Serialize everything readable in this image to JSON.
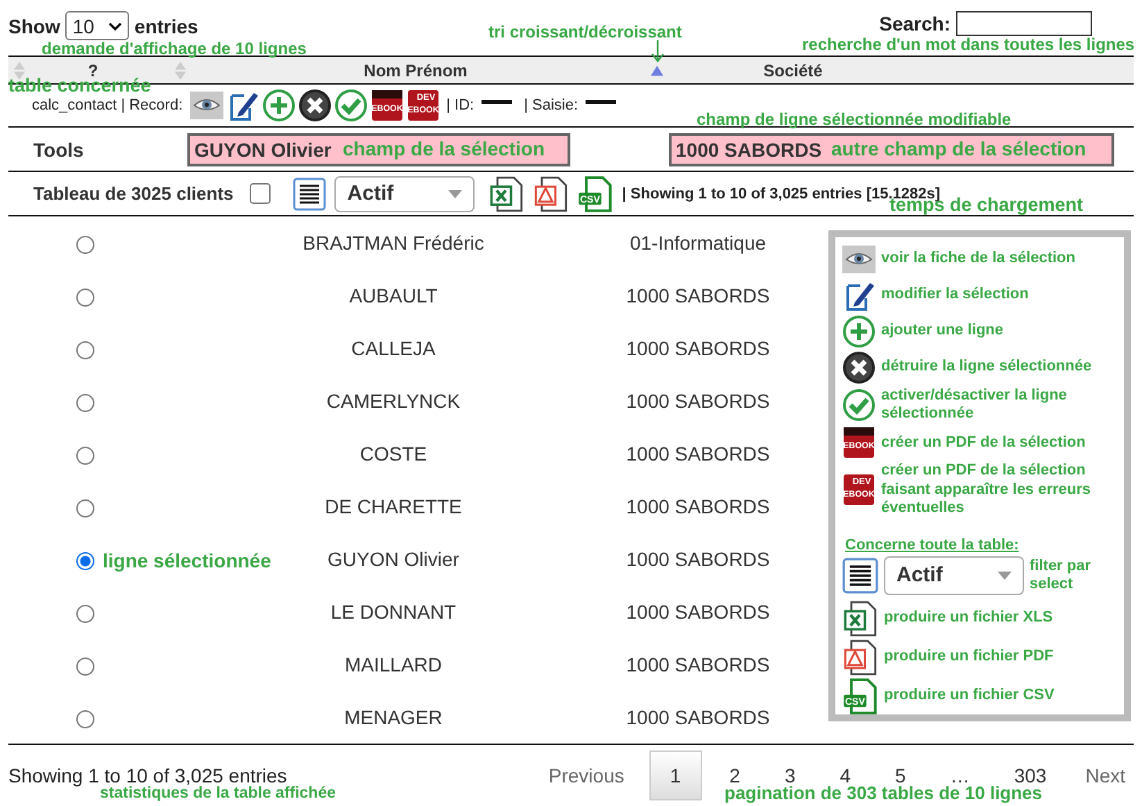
{
  "length_control": {
    "label_before": "Show",
    "value": "10",
    "label_after": "entries"
  },
  "search": {
    "label": "Search:"
  },
  "columns": [
    {
      "label": "?",
      "sorted": false
    },
    {
      "label": "Nom Prénom",
      "sorted": false
    },
    {
      "label": "Société",
      "sorted": true
    }
  ],
  "record_bar": {
    "table_label": "calc_contact | Record:",
    "tools": [
      {
        "kind": "view"
      },
      {
        "kind": "edit"
      },
      {
        "kind": "add"
      },
      {
        "kind": "delete"
      },
      {
        "kind": "toggle"
      },
      {
        "kind": "ebook",
        "badge": "EBOOK"
      },
      {
        "kind": "dev_ebook",
        "badge_top": "DEV",
        "badge": "EBOOK"
      }
    ],
    "id_label": "| ID:",
    "saisie_label": "| Saisie:"
  },
  "tools_row": {
    "label": "Tools",
    "fields": [
      {
        "value": "GUYON Olivier"
      },
      {
        "value": "1000 SABORDS"
      }
    ]
  },
  "table_toolbar": {
    "title": "Tableau de 3025 clients",
    "checked": false,
    "filter": {
      "value": "Actif"
    },
    "exports": [
      {
        "kind": "xls"
      },
      {
        "kind": "pdf"
      },
      {
        "kind": "csv",
        "badge": "CSV"
      }
    ],
    "info": "| Showing 1 to 10 of 3,025 entries [15.1282s]"
  },
  "rows": [
    {
      "name": "BRAJTMAN Frédéric",
      "company": "01-Informatique",
      "selected": false
    },
    {
      "name": "AUBAULT",
      "company": "1000 SABORDS",
      "selected": false
    },
    {
      "name": "CALLEJA",
      "company": "1000 SABORDS",
      "selected": false
    },
    {
      "name": "CAMERLYNCK",
      "company": "1000 SABORDS",
      "selected": false
    },
    {
      "name": "COSTE",
      "company": "1000 SABORDS",
      "selected": false
    },
    {
      "name": "DE CHARETTE",
      "company": "1000 SABORDS",
      "selected": false
    },
    {
      "name": "GUYON Olivier",
      "company": "1000 SABORDS",
      "selected": true
    },
    {
      "name": "LE DONNANT",
      "company": "1000 SABORDS",
      "selected": false
    },
    {
      "name": "MAILLARD",
      "company": "1000 SABORDS",
      "selected": false
    },
    {
      "name": "MENAGER",
      "company": "1000 SABORDS",
      "selected": false
    }
  ],
  "legend": {
    "items": [
      {
        "kind": "view",
        "text": "voir la fiche de la sélection"
      },
      {
        "kind": "edit",
        "text": "modifier la sélection"
      },
      {
        "kind": "add",
        "text": "ajouter une ligne"
      },
      {
        "kind": "delete",
        "text": "détruire la ligne sélectionnée"
      },
      {
        "kind": "toggle",
        "text": "activer/désactiver la ligne sélectionnée"
      },
      {
        "kind": "ebook",
        "badge": "EBOOK",
        "text": "créer un PDF de la sélection"
      },
      {
        "kind": "dev_ebook",
        "badge_top": "DEV",
        "badge": "EBOOK",
        "text": "créer un PDF de la sélection faisant apparaître les erreurs éventuelles"
      }
    ],
    "section_title": "Concerne toute la table:",
    "filter": {
      "value": "Actif",
      "text": "filter par select"
    },
    "exports": [
      {
        "kind": "xls",
        "text": "produire un fichier XLS"
      },
      {
        "kind": "pdf",
        "text": "produire un fichier PDF"
      },
      {
        "kind": "csv",
        "badge": "CSV",
        "text": "produire un fichier CSV"
      }
    ]
  },
  "footer": {
    "info": "Showing 1 to 10 of 3,025 entries",
    "pagination": [
      {
        "kind": "link",
        "label": "Previous",
        "selected": false
      },
      {
        "kind": "page",
        "label": "1",
        "selected": true
      },
      {
        "kind": "page",
        "label": "2",
        "selected": false
      },
      {
        "kind": "page",
        "label": "3",
        "selected": false
      },
      {
        "kind": "page",
        "label": "4",
        "selected": false
      },
      {
        "kind": "page",
        "label": "5",
        "selected": false
      },
      {
        "kind": "ellipsis",
        "label": "…"
      },
      {
        "kind": "page",
        "label": "303",
        "selected": false
      },
      {
        "kind": "link",
        "label": "Next",
        "selected": false
      }
    ]
  },
  "annotations": [
    {
      "kind": "length",
      "text": "demande d'affichage de 10 lignes"
    },
    {
      "kind": "sort",
      "text": "tri croissant/décroissant"
    },
    {
      "kind": "search",
      "text": "recherche d'un mot dans toutes les lignes"
    },
    {
      "kind": "table",
      "text": "table concernée"
    },
    {
      "kind": "editable",
      "text": "champ de ligne sélectionnée modifiable"
    },
    {
      "kind": "field_main",
      "text": "champ de la sélection"
    },
    {
      "kind": "field_other",
      "text": "autre champ de la sélection"
    },
    {
      "kind": "loadtime",
      "text": "temps de chargement"
    },
    {
      "kind": "selected_row",
      "text": "ligne sélectionnée"
    },
    {
      "kind": "stats",
      "text": "statistiques de la table affichée"
    },
    {
      "kind": "pagination",
      "text": "pagination de 303 tables de 10 lignes"
    }
  ]
}
